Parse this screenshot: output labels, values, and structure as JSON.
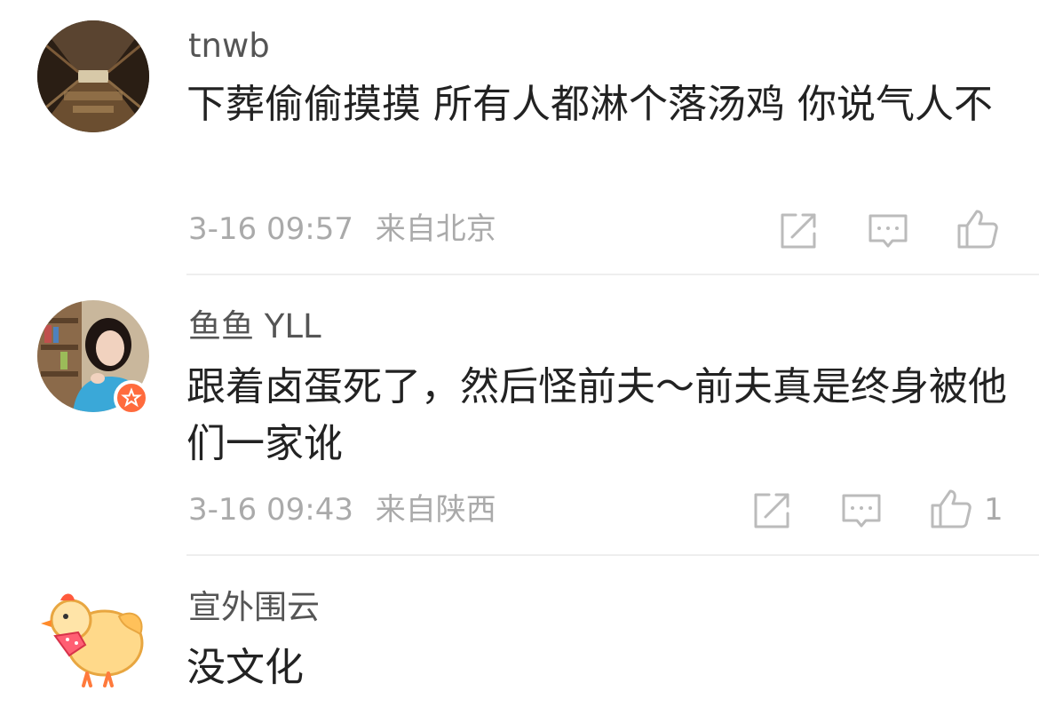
{
  "comments": [
    {
      "username": "tnwb",
      "text": "下葬偷偷摸摸 所有人都淋个落汤鸡 你说气人不",
      "time": "3-16 09:57",
      "location": "来自北京",
      "likes": ""
    },
    {
      "username": "鱼鱼 YLL",
      "text": "跟着卤蛋死了，然后怪前夫～前夫真是终身被他们一家讹",
      "time": "3-16 09:43",
      "location": "来自陕西",
      "likes": "1"
    },
    {
      "username": "宣外围云",
      "text": "没文化"
    }
  ],
  "colors": {
    "text": "#222222",
    "meta": "#aaaaaa",
    "icon": "#bbbbbb",
    "badge": "#ff6b3d"
  }
}
